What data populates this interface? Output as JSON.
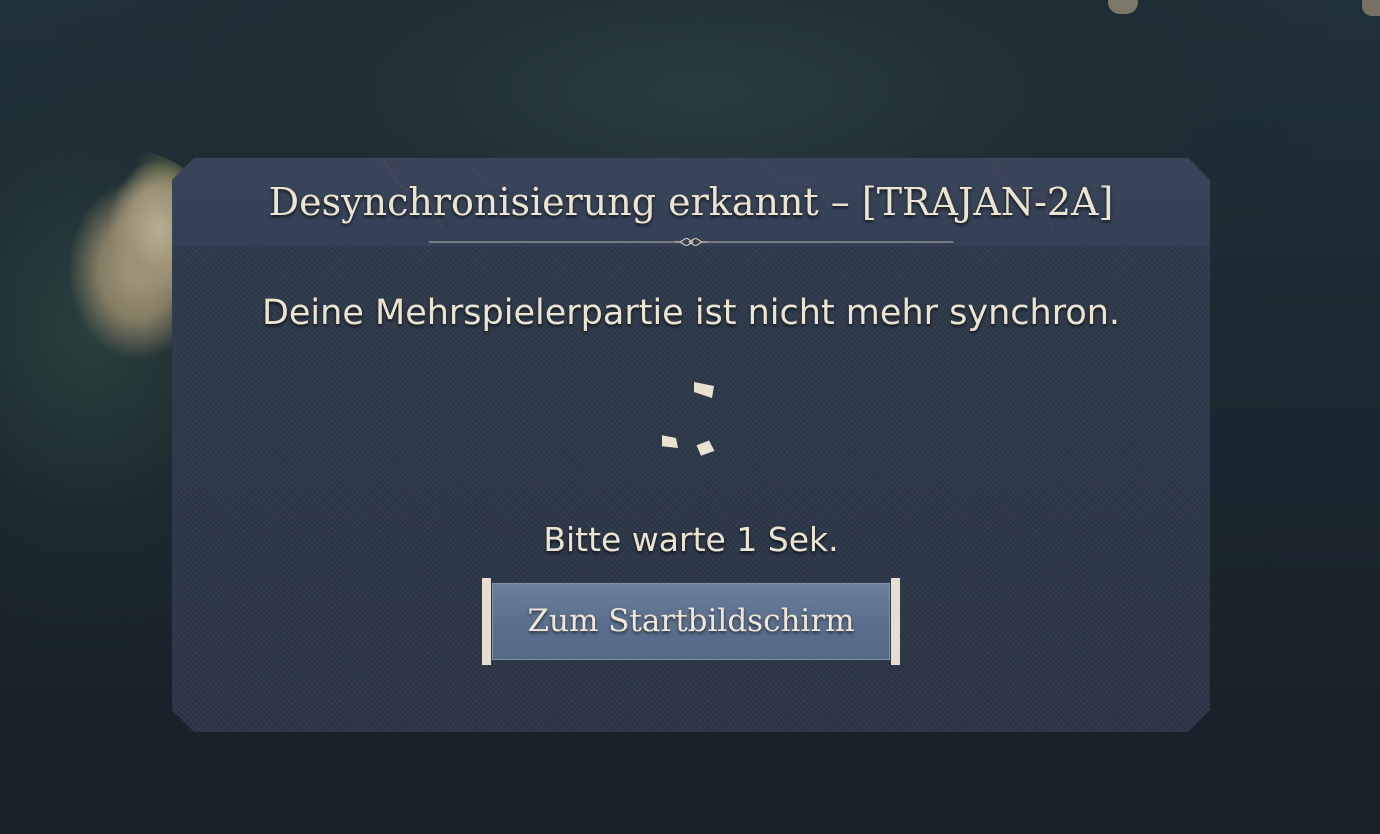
{
  "dialog": {
    "title": "Desynchronisierung erkannt – [TRAJAN-2A]",
    "message": "Deine Mehrspielerpartie ist nicht mehr synchron.",
    "wait_text": "Bitte warte 1 Sek.",
    "button_label": "Zum Startbildschirm"
  },
  "colors": {
    "panel": "#2c3747",
    "header": "#36435a",
    "text": "#ece4d2",
    "button": "#5e7290",
    "button_bar": "#e6dfd1"
  },
  "icons": {
    "spinner": "loading-spinner-icon",
    "header_ornament": "diamond-ornament-icon"
  }
}
